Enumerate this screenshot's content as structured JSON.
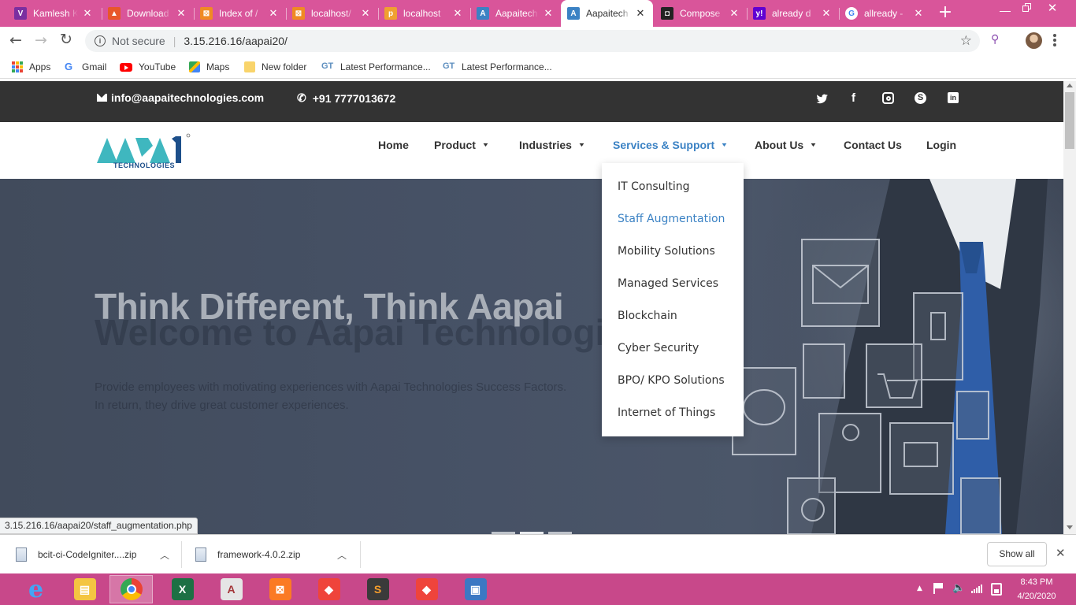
{
  "browser": {
    "tabs": [
      {
        "title": "Kamlesh Kumar",
        "icon": "vx-icon",
        "color": "#7b2fa0"
      },
      {
        "title": "Download",
        "icon": "fire-icon",
        "color": "#e8572a"
      },
      {
        "title": "Index of /",
        "icon": "xampp-icon",
        "color": "#f08a24"
      },
      {
        "title": "localhost/",
        "icon": "xampp-icon",
        "color": "#f08a24"
      },
      {
        "title": "localhost",
        "icon": "phpmyadmin-icon",
        "color": "#f0a030"
      },
      {
        "title": "Aapaitech",
        "icon": "a-icon",
        "color": "#3b82c4"
      },
      {
        "title": "Aapaitech",
        "icon": "a-icon",
        "color": "#3b82c4"
      },
      {
        "title": "Compose",
        "icon": "compose-icon",
        "color": "#222222"
      },
      {
        "title": "already d",
        "icon": "yahoo-icon",
        "color": "#6001d2"
      },
      {
        "title": "allready -",
        "icon": "google-icon",
        "color": "#4285f4"
      }
    ],
    "active_tab_index": 6,
    "new_tab": "+",
    "address": {
      "security": "Not secure",
      "separator": "|",
      "url": "3.15.216.16/aapai20/"
    },
    "bookmarks": [
      {
        "label": "Apps",
        "icon": "apps-grid-icon"
      },
      {
        "label": "Gmail",
        "icon": "google-icon"
      },
      {
        "label": "YouTube",
        "icon": "youtube-icon"
      },
      {
        "label": "Maps",
        "icon": "maps-icon"
      },
      {
        "label": "New folder",
        "icon": "folder-icon"
      },
      {
        "label": "Latest Performance...",
        "icon": "gt-icon"
      },
      {
        "label": "Latest Performance...",
        "icon": "gt-icon"
      }
    ]
  },
  "site": {
    "email": "info@aapaitechnologies.com",
    "phone": "+91 7777013672",
    "social": [
      "twitter-icon",
      "facebook-icon",
      "instagram-icon",
      "skype-icon",
      "linkedin-icon"
    ],
    "logo": {
      "text": "AAPAI",
      "sub": "TECHNOLOGIES",
      "mark": "®"
    },
    "nav": [
      {
        "label": "Home",
        "dropdown": false
      },
      {
        "label": "Product",
        "dropdown": true
      },
      {
        "label": "Industries",
        "dropdown": true
      },
      {
        "label": "Services & Support",
        "dropdown": true,
        "active": true
      },
      {
        "label": "About Us",
        "dropdown": true
      },
      {
        "label": "Contact Us",
        "dropdown": false
      },
      {
        "label": "Login",
        "dropdown": false
      }
    ],
    "hero": {
      "heading": "Think Different, Think Aapai",
      "ghost_heading": "Welcome to Aapai Technologies",
      "ghost_line1": "Provide employees with motivating experiences with Aapai Technologies Success Factors.",
      "ghost_line2": "In return, they drive great customer experiences."
    },
    "services_menu": [
      "IT Consulting",
      "Staff Augmentation",
      "Mobility Solutions",
      "Managed Services",
      "Blockchain",
      "Cyber Security",
      "BPO/ KPO Solutions",
      "Internet of Things"
    ],
    "hovered_menu_index": 1,
    "accent": "#3b82c4"
  },
  "status_url": "3.15.216.16/aapai20/staff_augmentation.php",
  "downloads": {
    "items": [
      "bcit-ci-CodeIgniter....zip",
      "framework-4.0.2.zip"
    ],
    "show_all": "Show all"
  },
  "taskbar": {
    "apps": [
      "internet-explorer-icon",
      "file-explorer-icon",
      "chrome-icon",
      "excel-icon",
      "access-icon",
      "xampp-icon",
      "anydesk-icon",
      "sublime-icon",
      "anydesk-icon",
      "remote-desktop-icon"
    ],
    "time": "8:43 PM",
    "date": "4/20/2020"
  }
}
